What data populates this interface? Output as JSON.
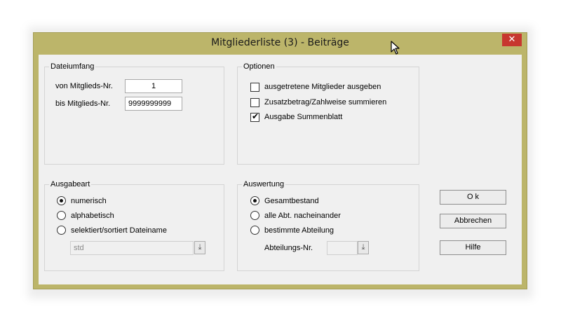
{
  "window": {
    "title": "Mitgliederliste (3)  -  Beiträge",
    "close_glyph": "✕"
  },
  "dateiumfang": {
    "legend": "Dateiumfang",
    "von_label": "von Mitglieds-Nr.",
    "von_value": "1",
    "bis_label": "bis  Mitglieds-Nr.",
    "bis_value": "9999999999"
  },
  "optionen": {
    "legend": "Optionen",
    "items": [
      {
        "label": "ausgetretene Mitglieder ausgeben",
        "checked": false
      },
      {
        "label": "Zusatzbetrag/Zahlweise summieren",
        "checked": false
      },
      {
        "label": "Ausgabe Summenblatt",
        "checked": true
      }
    ],
    "checkmark": "✔"
  },
  "ausgabeart": {
    "legend": "Ausgabeart",
    "items": [
      {
        "label": "numerisch",
        "selected": true
      },
      {
        "label": "alphabetisch",
        "selected": false
      },
      {
        "label": "selektiert/sortiert Dateiname",
        "selected": false
      }
    ],
    "dateiname_value": "std"
  },
  "auswertung": {
    "legend": "Auswertung",
    "items": [
      {
        "label": "Gesamtbestand",
        "selected": true
      },
      {
        "label": "alle Abt. nacheinander",
        "selected": false
      },
      {
        "label": "bestimmte Abteilung",
        "selected": false
      }
    ],
    "abteilung_label": "Abteilungs-Nr.",
    "abteilung_value": ""
  },
  "dropdown_glyph": "⤓",
  "buttons": {
    "ok": "O k",
    "abbrechen": "Abbrechen",
    "hilfe": "Hilfe"
  }
}
